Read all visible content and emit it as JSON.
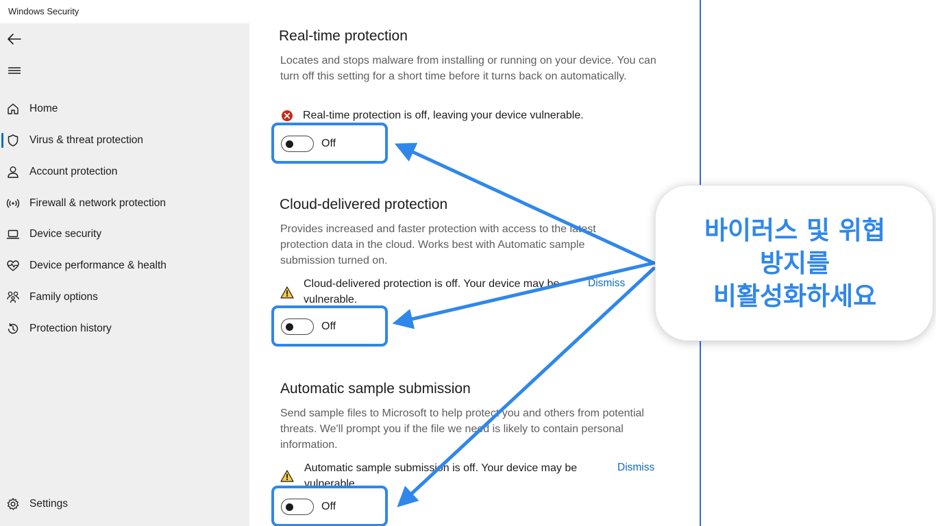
{
  "window": {
    "title": "Windows Security"
  },
  "sidebar": {
    "items": [
      {
        "label": "Home",
        "icon": "home-icon"
      },
      {
        "label": "Virus & threat protection",
        "icon": "shield-icon",
        "active": true
      },
      {
        "label": "Account protection",
        "icon": "person-icon"
      },
      {
        "label": "Firewall & network protection",
        "icon": "wifi-icon"
      },
      {
        "label": "Device security",
        "icon": "laptop-icon"
      },
      {
        "label": "Device performance & health",
        "icon": "heart-pulse-icon"
      },
      {
        "label": "Family options",
        "icon": "family-icon"
      },
      {
        "label": "Protection history",
        "icon": "history-icon"
      }
    ],
    "settings_label": "Settings"
  },
  "sections": {
    "realtime": {
      "title": "Real-time protection",
      "description": "Locates and stops malware from installing or running on your device. You can turn off this setting for a short time before it turns back on automatically.",
      "status": "Real-time protection is off, leaving your device vulnerable.",
      "toggle_state": "Off"
    },
    "cloud": {
      "title": "Cloud-delivered protection",
      "description": "Provides increased and faster protection with access to the latest protection data in the cloud. Works best with Automatic sample submission turned on.",
      "status": "Cloud-delivered protection is off. Your device may be vulnerable.",
      "dismiss": "Dismiss",
      "toggle_state": "Off"
    },
    "sample": {
      "title": "Automatic sample submission",
      "description": "Send sample files to Microsoft to help protect you and others from potential threats. We'll prompt you if the file we need is likely to contain personal information.",
      "status": "Automatic sample submission is off. Your device may be vulnerable.",
      "dismiss": "Dismiss",
      "toggle_state": "Off"
    }
  },
  "callout": {
    "lines": [
      "바이러스 및 위협",
      "방지를",
      "비활성화하세요"
    ]
  },
  "colors": {
    "accent": "#0f6cbd",
    "annotation": "#2f87eb",
    "error": "#c42b1c",
    "warning": "#f7c948"
  }
}
